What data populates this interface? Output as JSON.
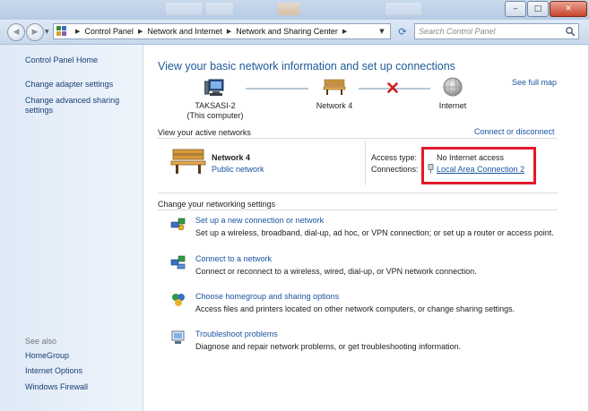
{
  "window": {
    "controls": {
      "minimize": "‒",
      "maximize": "□",
      "close": "✕"
    }
  },
  "address_bar": {
    "back_glyph": "◀",
    "forward_glyph": "▶",
    "breadcrumbs": [
      "Control Panel",
      "Network and Internet",
      "Network and Sharing Center"
    ],
    "separator": "▶",
    "dropdown_glyph": "▼",
    "refresh_glyph": "⟳",
    "search_placeholder": "Search Control Panel"
  },
  "sidebar": {
    "home": "Control Panel Home",
    "links": [
      "Change adapter settings",
      "Change advanced sharing settings"
    ],
    "see_also_title": "See also",
    "see_also": [
      "HomeGroup",
      "Internet Options",
      "Windows Firewall"
    ]
  },
  "main": {
    "heading": "View your basic network information and set up connections",
    "see_full_map": "See full map",
    "map": {
      "computer_name": "TAKSASI-2",
      "computer_sub": "(This computer)",
      "network_name": "Network  4",
      "internet": "Internet"
    },
    "active_title": "View your active networks",
    "connect_disconnect": "Connect or disconnect",
    "active": {
      "name": "Network  4",
      "type": "Public network",
      "access_type_label": "Access type:",
      "access_type_value": "No Internet access",
      "connections_label": "Connections:",
      "connection_link": "Local Area Connection 2"
    },
    "settings_title": "Change your networking settings",
    "tasks": [
      {
        "link": "Set up a new connection or network",
        "desc": "Set up a wireless, broadband, dial-up, ad hoc, or VPN connection; or set up a router or access point.",
        "icon": "new-connection-icon"
      },
      {
        "link": "Connect to a network",
        "desc": "Connect or reconnect to a wireless, wired, dial-up, or VPN network connection.",
        "icon": "connect-network-icon"
      },
      {
        "link": "Choose homegroup and sharing options",
        "desc": "Access files and printers located on other network computers, or change sharing settings.",
        "icon": "homegroup-icon"
      },
      {
        "link": "Troubleshoot problems",
        "desc": "Diagnose and repair network problems, or get troubleshooting information.",
        "icon": "troubleshoot-icon"
      }
    ]
  },
  "colors": {
    "link": "#1a55a2",
    "heading": "#1e5a99",
    "highlight_box": "#e2192a",
    "no_connection_x": "#d31b1b"
  }
}
